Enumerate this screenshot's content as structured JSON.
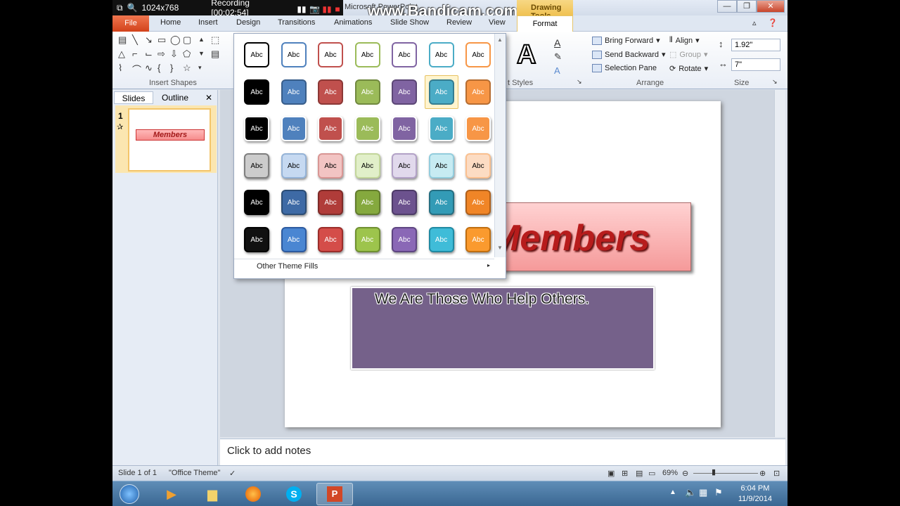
{
  "recorder": {
    "resolution": "1024x768",
    "status": "Recording [00:02:54]"
  },
  "window": {
    "title": "Microsoft PowerPoint",
    "watermark": "www.Bandicam.com",
    "context_tab": "Drawing Tools",
    "minimize": "—",
    "restore": "❐",
    "close": "✕"
  },
  "tabs": {
    "file": "File",
    "home": "Home",
    "insert": "Insert",
    "design": "Design",
    "transitions": "Transitions",
    "animations": "Animations",
    "slideshow": "Slide Show",
    "review": "Review",
    "view": "View",
    "format": "Format"
  },
  "ribbon": {
    "insert_shapes_label": "Insert Shapes",
    "wordart_styles_label": "t Styles",
    "arrange_label": "Arrange",
    "size_label": "Size",
    "bring_forward": "Bring Forward",
    "send_backward": "Send Backward",
    "selection_pane": "Selection Pane",
    "align": "Align",
    "group": "Group",
    "rotate": "Rotate",
    "height": "1.92\"",
    "width": "7\""
  },
  "leftpane": {
    "slides_tab": "Slides",
    "outline_tab": "Outline",
    "close": "✕",
    "slide_number": "1",
    "thumb_title": "Members"
  },
  "slide": {
    "title": "Members",
    "subtitle": "We Are Those Who Help Others."
  },
  "notes": {
    "placeholder": "Click to add notes"
  },
  "status": {
    "slide": "Slide 1 of 1",
    "theme": "\"Office Theme\"",
    "zoom": "69%"
  },
  "taskbar": {
    "time": "6:04 PM",
    "date": "11/9/2014"
  },
  "gallery": {
    "item_label": "Abc",
    "footer": "Other Theme Fills",
    "rows": [
      [
        {
          "fill": "#ffffff",
          "border": "#000000",
          "text": "#000"
        },
        {
          "fill": "#ffffff",
          "border": "#4f81bd",
          "text": "#000"
        },
        {
          "fill": "#ffffff",
          "border": "#c0504d",
          "text": "#000"
        },
        {
          "fill": "#ffffff",
          "border": "#9bbb59",
          "text": "#000"
        },
        {
          "fill": "#ffffff",
          "border": "#8064a2",
          "text": "#000"
        },
        {
          "fill": "#ffffff",
          "border": "#4bacc6",
          "text": "#000"
        },
        {
          "fill": "#ffffff",
          "border": "#f79646",
          "text": "#000"
        }
      ],
      [
        {
          "fill": "#000000",
          "border": "#000000",
          "text": "#fff"
        },
        {
          "fill": "#4f81bd",
          "border": "#385d8a",
          "text": "#fff"
        },
        {
          "fill": "#c0504d",
          "border": "#8c3836",
          "text": "#fff"
        },
        {
          "fill": "#9bbb59",
          "border": "#71893f",
          "text": "#fff"
        },
        {
          "fill": "#8064a2",
          "border": "#5c4776",
          "text": "#fff"
        },
        {
          "fill": "#4bacc6",
          "border": "#357d91",
          "text": "#fff"
        },
        {
          "fill": "#f79646",
          "border": "#b66d31",
          "text": "#fff"
        }
      ],
      [
        {
          "fill": "#000000",
          "border": "#ffffff",
          "text": "#fff"
        },
        {
          "fill": "#4f81bd",
          "border": "#ffffff",
          "text": "#fff"
        },
        {
          "fill": "#c0504d",
          "border": "#ffffff",
          "text": "#fff"
        },
        {
          "fill": "#9bbb59",
          "border": "#ffffff",
          "text": "#fff"
        },
        {
          "fill": "#8064a2",
          "border": "#ffffff",
          "text": "#fff"
        },
        {
          "fill": "#4bacc6",
          "border": "#ffffff",
          "text": "#fff"
        },
        {
          "fill": "#f79646",
          "border": "#ffffff",
          "text": "#fff"
        }
      ],
      [
        {
          "fill": "#cccccc",
          "border": "#7f7f7f",
          "text": "#000"
        },
        {
          "fill": "#c6d9f1",
          "border": "#95b3d7",
          "text": "#000"
        },
        {
          "fill": "#f2c4c3",
          "border": "#d99694",
          "text": "#000"
        },
        {
          "fill": "#e1efc9",
          "border": "#c3d69b",
          "text": "#000"
        },
        {
          "fill": "#e1d9ec",
          "border": "#b3a2c7",
          "text": "#000"
        },
        {
          "fill": "#c7ebf2",
          "border": "#93cddd",
          "text": "#000"
        },
        {
          "fill": "#fcdcc3",
          "border": "#fac090",
          "text": "#000"
        }
      ],
      [
        {
          "fill": "#000000",
          "border": "#000000",
          "text": "#fff"
        },
        {
          "fill": "#3e6aa5",
          "border": "#2c4d75",
          "text": "#fff"
        },
        {
          "fill": "#b03c39",
          "border": "#7e2b28",
          "text": "#fff"
        },
        {
          "fill": "#85a93e",
          "border": "#627c2d",
          "text": "#fff"
        },
        {
          "fill": "#6c528e",
          "border": "#4e3b68",
          "text": "#fff"
        },
        {
          "fill": "#339bb6",
          "border": "#256f82",
          "text": "#fff"
        },
        {
          "fill": "#f08527",
          "border": "#b1601a",
          "text": "#fff"
        }
      ],
      [
        {
          "fill": "#111111",
          "border": "#000000",
          "text": "#fff"
        },
        {
          "fill": "#4a86d2",
          "border": "#2c5aa0",
          "text": "#fff"
        },
        {
          "fill": "#d44d49",
          "border": "#9b2d2a",
          "text": "#fff"
        },
        {
          "fill": "#9dc44c",
          "border": "#6f9030",
          "text": "#fff"
        },
        {
          "fill": "#8a68b6",
          "border": "#5e4582",
          "text": "#fff"
        },
        {
          "fill": "#3fbcd8",
          "border": "#1f8aa3",
          "text": "#fff"
        },
        {
          "fill": "#fa9a2e",
          "border": "#c06e10",
          "text": "#fff"
        }
      ]
    ],
    "selected": [
      1,
      5
    ]
  }
}
